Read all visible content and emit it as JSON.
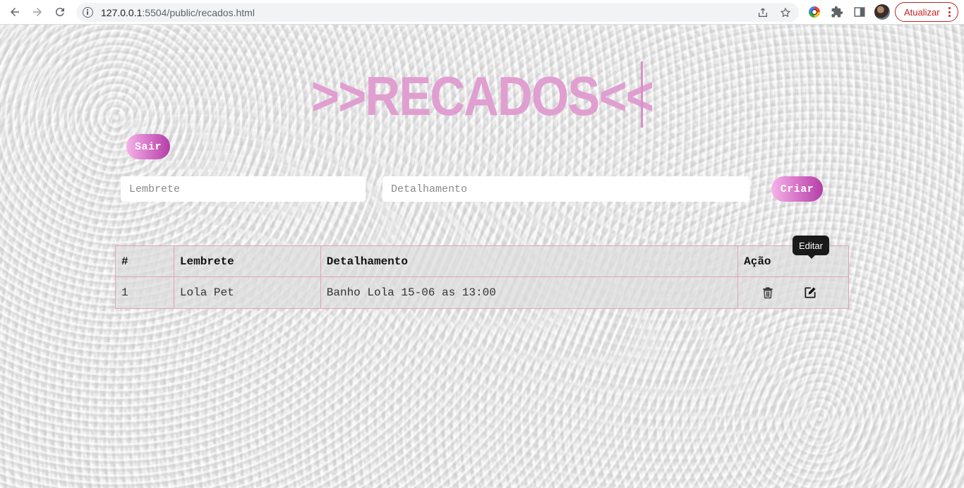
{
  "browser": {
    "url_host": "127.0.0.1",
    "url_rest": ":5504/public/recados.html",
    "update_label": "Atualizar"
  },
  "page": {
    "title": ">>RECADOS<<",
    "logout_label": "Sair",
    "create_label": "Criar",
    "inputs": {
      "reminder_placeholder": "Lembrete",
      "reminder_value": "",
      "detail_placeholder": "Detalhamento",
      "detail_value": ""
    },
    "table": {
      "headers": [
        "#",
        "Lembrete",
        "Detalhamento",
        "Ação"
      ],
      "rows": [
        {
          "id": "1",
          "reminder": "Lola Pet",
          "detail": "Banho Lola 15-06 as 13:00"
        }
      ]
    },
    "tooltip": "Editar"
  },
  "colors": {
    "title": "#e09fd0",
    "button_gradient_start": "#f5b3e8",
    "button_gradient_end": "#b23ea6",
    "table_border": "#e0a5b8"
  },
  "icons": {
    "delete": "trash-icon",
    "edit": "edit-icon"
  }
}
